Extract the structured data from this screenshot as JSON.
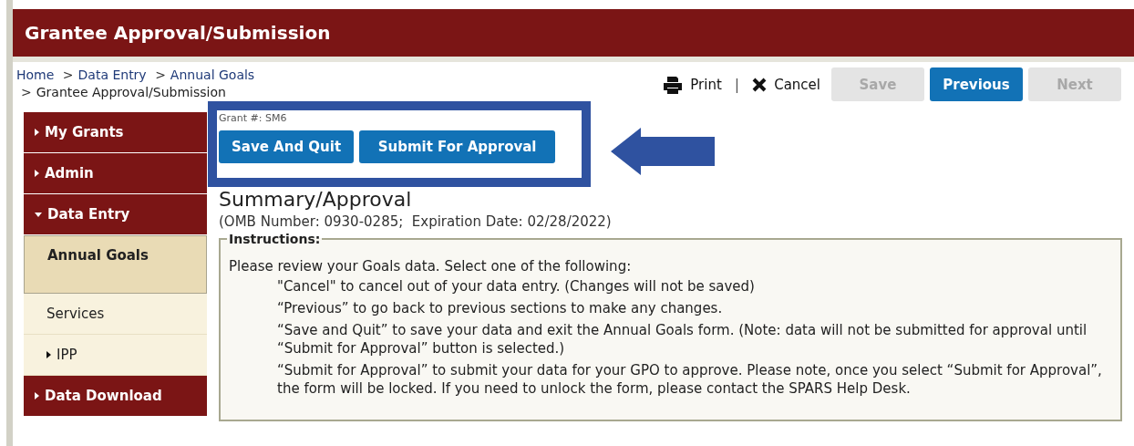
{
  "header": {
    "title": "Grantee Approval/Submission"
  },
  "breadcrumb": [
    {
      "label": "Home",
      "link": true
    },
    {
      "label": "Data Entry",
      "link": true
    },
    {
      "label": "Annual Goals",
      "link": true
    },
    {
      "label": "Grantee Approval/Submission",
      "link": false
    }
  ],
  "breadcrumb_separators": [
    ">",
    ">",
    ">"
  ],
  "toolbar": {
    "print": "Print",
    "separator": "|",
    "cancel": "Cancel",
    "buttons": [
      {
        "label": "Save",
        "disabled": true
      },
      {
        "label": "Previous",
        "disabled": false
      },
      {
        "label": "Next",
        "disabled": true
      }
    ]
  },
  "sidebar": {
    "items": [
      {
        "label": "My Grants",
        "expanded": false
      },
      {
        "label": "Admin",
        "expanded": false
      },
      {
        "label": "Data Entry",
        "expanded": true,
        "children": [
          {
            "label": "Annual Goals",
            "selected": true
          },
          {
            "label": "Services",
            "selected": false
          },
          {
            "label": "IPP",
            "selected": false,
            "expanded": false
          }
        ]
      },
      {
        "label": "Data Download",
        "expanded": false
      }
    ]
  },
  "grant": "Grant #: SM6",
  "actions": [
    "Save And Quit",
    "Submit For Approval"
  ],
  "heading": "Summary/Approval",
  "omb": "(OMB Number: 0930-0285;  Expiration Date: 02/28/2022)",
  "instructions": {
    "legend": "Instructions:",
    "intro": "Please review your Goals data. Select one of the following:",
    "items": [
      "\"Cancel\" to cancel out of your data entry. (Changes will not be saved)",
      "“Previous” to go back to previous sections to make any changes.",
      "“Save and Quit” to save your data and exit the Annual Goals form. (Note: data will not be submitted for approval until “Submit for Approval” button is selected.)",
      "“Submit for Approval” to submit your data for your GPO to approve. Please note, once you select “Submit for Approval”, the form will be locked. If you need to unlock the form, please contact the SPARS Help Desk."
    ]
  },
  "callout": {
    "highlight": true
  }
}
